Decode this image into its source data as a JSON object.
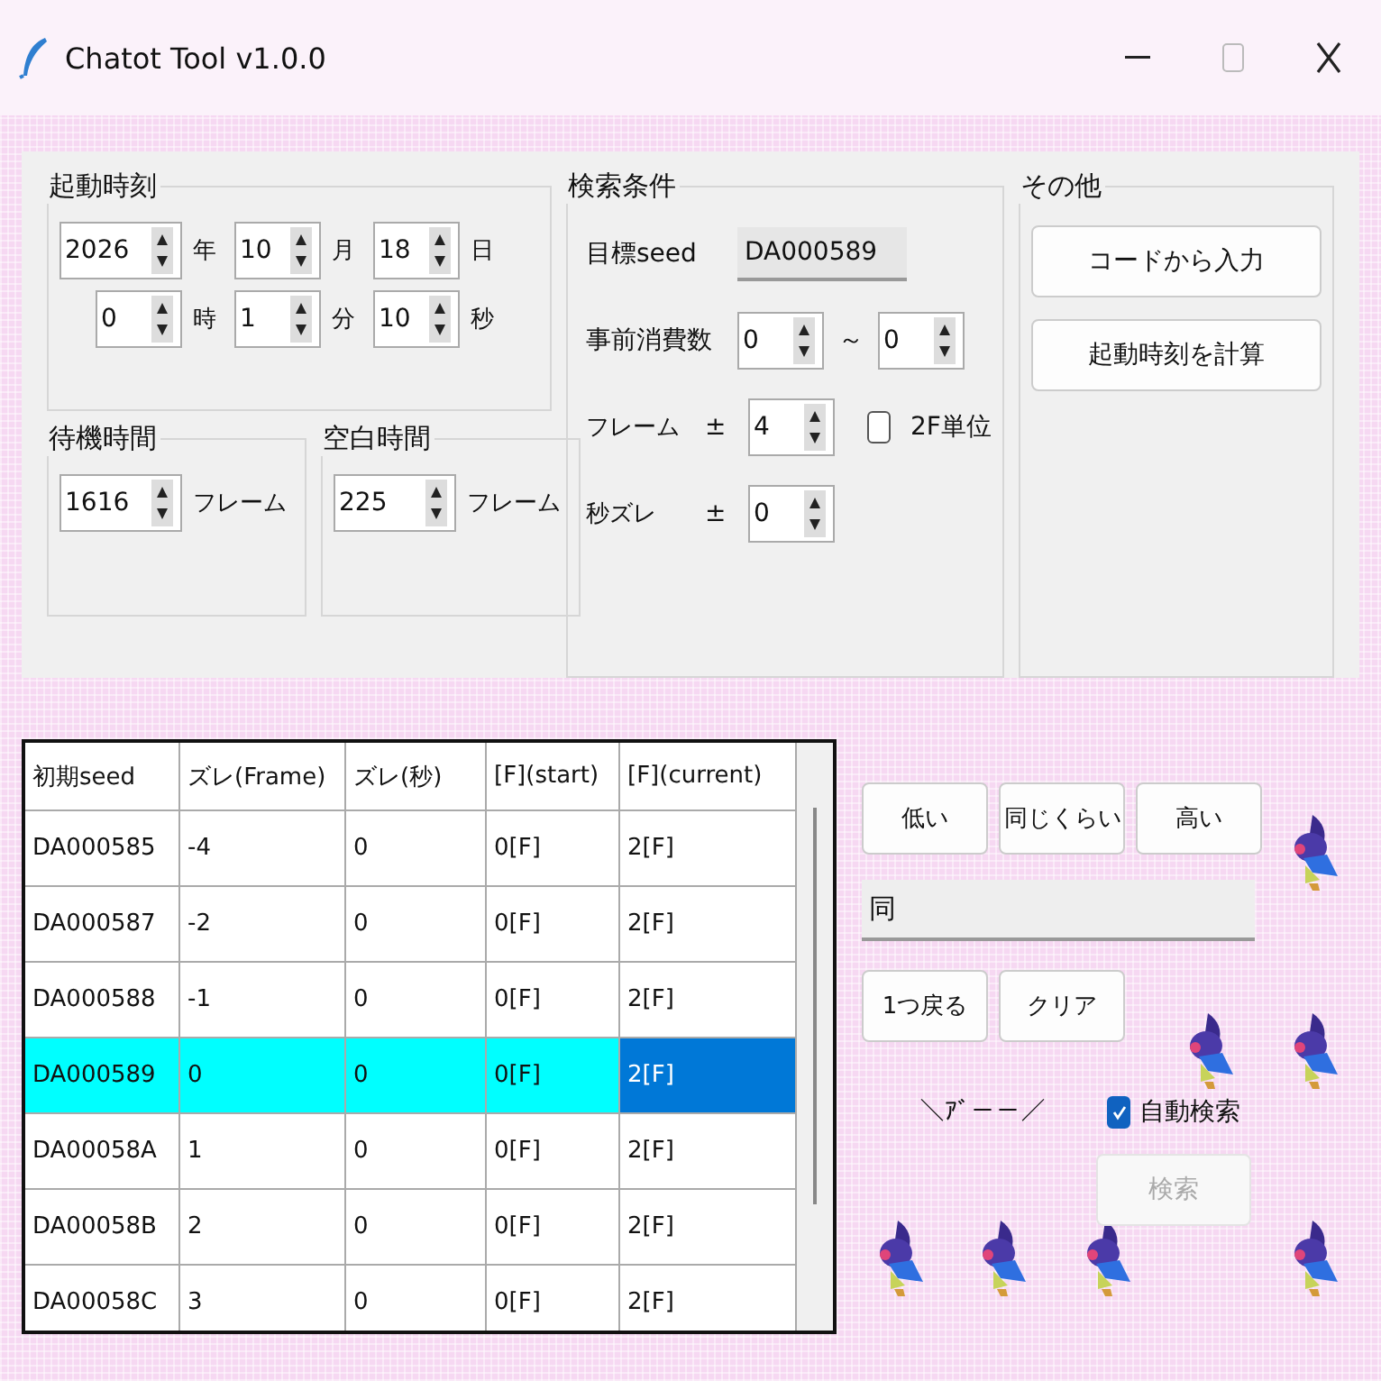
{
  "window": {
    "title": "Chatot Tool v1.0.0"
  },
  "startup": {
    "title": "起動時刻",
    "rows": [
      [
        {
          "value": "2026",
          "unit": "年"
        },
        {
          "value": "10",
          "unit": "月"
        },
        {
          "value": "18",
          "unit": "日"
        }
      ],
      [
        {
          "value": "0",
          "unit": "時"
        },
        {
          "value": "1",
          "unit": "分"
        },
        {
          "value": "10",
          "unit": "秒"
        }
      ]
    ]
  },
  "wait": {
    "title": "待機時間",
    "value": "1616",
    "unit": "フレーム"
  },
  "blank": {
    "title": "空白時間",
    "value": "225",
    "unit": "フレーム"
  },
  "search": {
    "title": "検索条件",
    "target_label": "目標seed",
    "target_value": "DA000589",
    "advance_label": "事前消費数",
    "advance_from": "0",
    "advance_sep": "～",
    "advance_to": "0",
    "frame_label": "フレーム",
    "frame_pm": "±",
    "frame_value": "4",
    "two_frame": {
      "label": "2F単位",
      "checked": false
    },
    "second_label": "秒ズレ",
    "second_pm": "±",
    "second_value": "0"
  },
  "other": {
    "title": "その他",
    "buttons": [
      "コードから入力",
      "起動時刻を計算"
    ]
  },
  "table": {
    "columns": [
      "初期seed",
      "ズレ(Frame)",
      "ズレ(秒)",
      "[F](start)",
      "[F](current)"
    ],
    "rows": [
      {
        "cells": [
          "DA000585",
          "-4",
          "0",
          "0[F]",
          "2[F]"
        ],
        "selected": false,
        "focused": false
      },
      {
        "cells": [
          "DA000587",
          "-2",
          "0",
          "0[F]",
          "2[F]"
        ],
        "selected": false,
        "focused": false
      },
      {
        "cells": [
          "DA000588",
          "-1",
          "0",
          "0[F]",
          "2[F]"
        ],
        "selected": false,
        "focused": false
      },
      {
        "cells": [
          "DA000589",
          "0",
          "0",
          "0[F]",
          "2[F]"
        ],
        "selected": true,
        "focused": true
      },
      {
        "cells": [
          "DA00058A",
          "1",
          "0",
          "0[F]",
          "2[F]"
        ],
        "selected": false,
        "focused": false
      },
      {
        "cells": [
          "DA00058B",
          "2",
          "0",
          "0[F]",
          "2[F]"
        ],
        "selected": false,
        "focused": false
      },
      {
        "cells": [
          "DA00058C",
          "3",
          "0",
          "0[F]",
          "2[F]"
        ],
        "selected": false,
        "focused": false
      }
    ]
  },
  "judge": {
    "buttons": [
      "低い",
      "同じくらい",
      "高い"
    ],
    "result": "同",
    "actions": [
      "1つ戻る",
      "クリア"
    ],
    "cry": "＼ｱﾞ－－／",
    "auto_search": {
      "label": "自動検索",
      "checked": true
    },
    "search_button": {
      "label": "検索",
      "disabled": true
    }
  }
}
